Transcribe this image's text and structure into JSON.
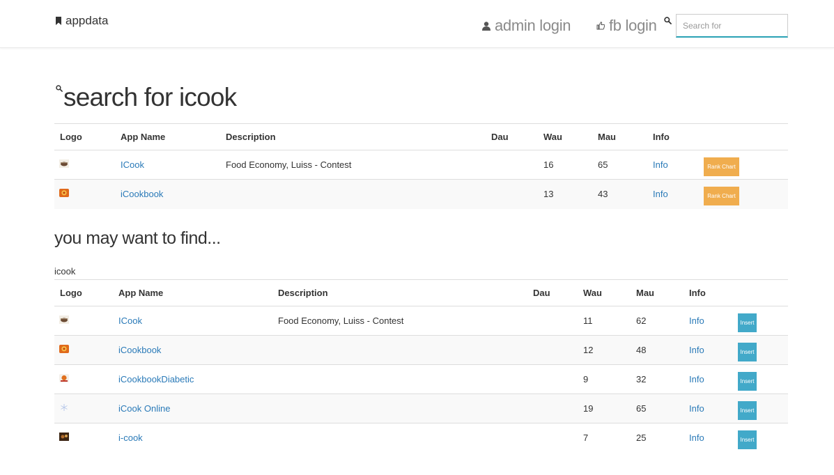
{
  "navbar": {
    "brand": "appdata",
    "admin_login": "admin login",
    "fb_login": "fb login",
    "search_placeholder": "Search for"
  },
  "search": {
    "heading": "search for icook"
  },
  "results": {
    "columns": [
      "Logo",
      "App Name",
      "Description",
      "Dau",
      "Wau",
      "Mau",
      "Info",
      ""
    ],
    "rows": [
      {
        "logo_icon": "cooking-pot-icon",
        "name": "ICook",
        "description": "Food Economy, Luiss - Contest",
        "dau": "",
        "wau": "16",
        "mau": "65",
        "info": "Info",
        "action": "Rank Chart"
      },
      {
        "logo_icon": "icookbook-logo-icon",
        "name": "iCookbook",
        "description": "",
        "dau": "",
        "wau": "13",
        "mau": "43",
        "info": "Info",
        "action": "Rank Chart"
      }
    ]
  },
  "suggestions": {
    "heading": "you may want to find...",
    "query": "icook",
    "columns": [
      "Logo",
      "App Name",
      "Description",
      "Dau",
      "Wau",
      "Mau",
      "Info",
      ""
    ],
    "rows": [
      {
        "logo_icon": "cooking-pot-icon",
        "name": "ICook",
        "description": "Food Economy, Luiss - Contest",
        "dau": "",
        "wau": "11",
        "mau": "62",
        "info": "Info",
        "action": "Insert"
      },
      {
        "logo_icon": "icookbook-logo-icon",
        "name": "iCookbook",
        "description": "",
        "dau": "",
        "wau": "12",
        "mau": "48",
        "info": "Info",
        "action": "Insert"
      },
      {
        "logo_icon": "icookbook-diabetic-logo-icon",
        "name": "iCookbookDiabetic",
        "description": "",
        "dau": "",
        "wau": "9",
        "mau": "32",
        "info": "Info",
        "action": "Insert"
      },
      {
        "logo_icon": "snowflake-logo-icon",
        "name": "iCook Online",
        "description": "",
        "dau": "",
        "wau": "19",
        "mau": "65",
        "info": "Info",
        "action": "Insert"
      },
      {
        "logo_icon": "food-photo-logo-icon",
        "name": "i-cook",
        "description": "",
        "dau": "",
        "wau": "7",
        "mau": "25",
        "info": "Info",
        "action": "Insert"
      }
    ]
  },
  "colors": {
    "link": "#2a7ab8",
    "rank_button": "#f0ad4e",
    "insert_button": "#42a9c9",
    "search_focus": "#2aa1b5"
  }
}
